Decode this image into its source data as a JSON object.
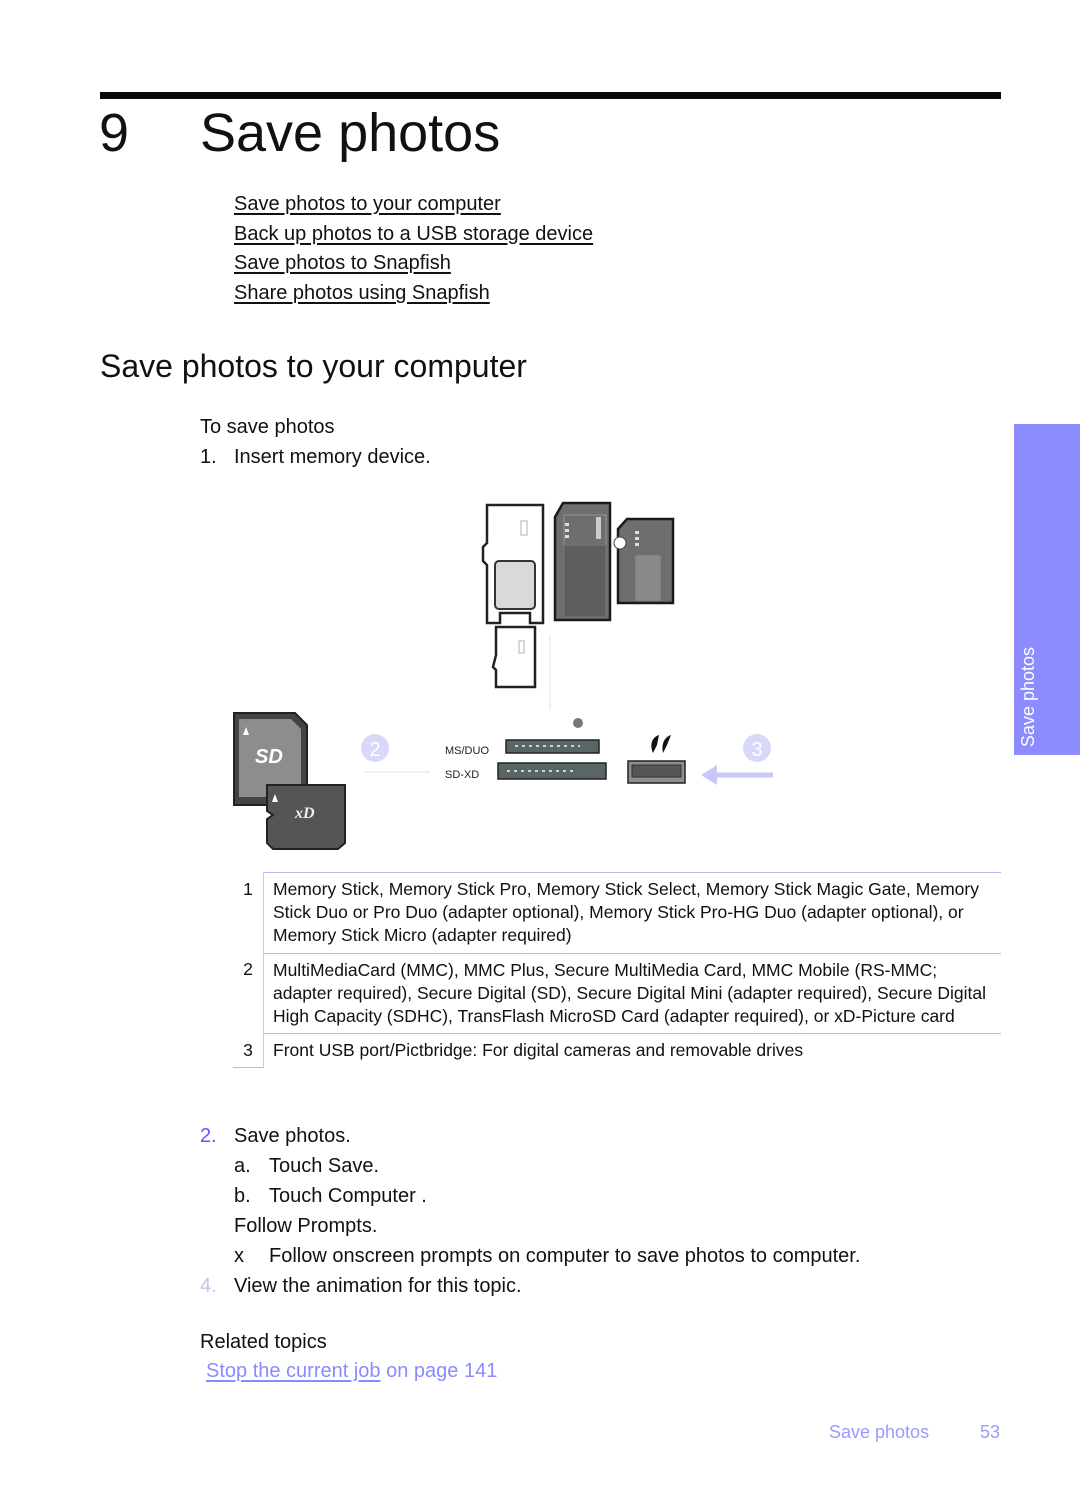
{
  "chapter": {
    "number": "9",
    "title": "Save photos"
  },
  "toc": [
    {
      "label": "Save photos to your computer"
    },
    {
      "label": "Back up photos to a USB storage device"
    },
    {
      "label": "Save photos to Snapfish"
    },
    {
      "label": "Share photos using Snapfish"
    }
  ],
  "section": {
    "title": "Save photos to your computer",
    "procedure_heading": "To save photos",
    "step1": {
      "number": "1.",
      "text": "Insert memory device."
    }
  },
  "figure": {
    "slot_labels": {
      "ms_duo": "MS/DUO",
      "sd_xd": "SD-XD"
    },
    "callouts": [
      "2",
      "3"
    ],
    "card_logos": {
      "sd": "SD",
      "xd": "xD"
    },
    "callout_color": "#d8d8fb"
  },
  "legend_table": [
    {
      "num": "1",
      "text": "Memory Stick, Memory Stick Pro, Memory Stick Select, Memory Stick Magic Gate, Memory Stick Duo or Pro Duo (adapter optional), Memory Stick Pro-HG Duo (adapter optional), or Memory Stick Micro (adapter required)"
    },
    {
      "num": "2",
      "text": "MultiMediaCard (MMC), MMC Plus, Secure MultiMedia Card, MMC Mobile (RS-MMC; adapter required), Secure Digital (SD), Secure Digital Mini (adapter required), Secure Digital High Capacity (SDHC), TransFlash MicroSD Card (adapter required), or xD-Picture card"
    },
    {
      "num": "3",
      "text": "Front USB port/Pictbridge: For digital cameras and removable drives"
    }
  ],
  "steps": {
    "step2": {
      "number": "2.",
      "text": "Save photos."
    },
    "a": {
      "label": "a.",
      "text": "Touch Save."
    },
    "b": {
      "label": "b.",
      "text": "Touch Computer ."
    },
    "follow": "Follow Prompts.",
    "x": {
      "label": "x",
      "text": "Follow onscreen prompts on computer to save photos to computer."
    },
    "step4": {
      "number": "4.",
      "text": "View the animation for this topic."
    }
  },
  "related": {
    "heading": "Related topics",
    "link_label": "Stop the current job",
    "page_ref": "on page 141"
  },
  "side_tab": {
    "label": "Save photos",
    "color": "#8c8cff"
  },
  "footer": {
    "section": "Save photos",
    "page": "53"
  }
}
